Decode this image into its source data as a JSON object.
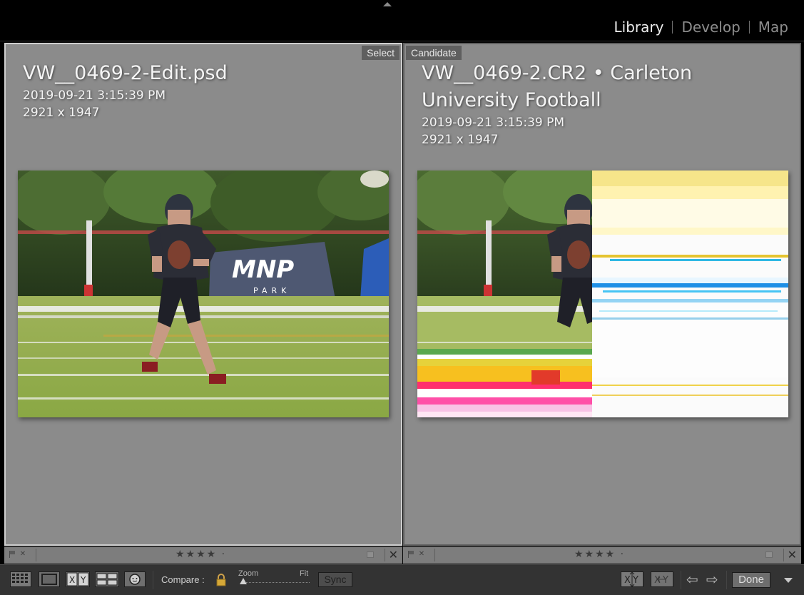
{
  "modules": [
    "Library",
    "Develop",
    "Map"
  ],
  "active_module": "Library",
  "select": {
    "tag": "Select",
    "filename": "VW__0469-2-Edit.psd",
    "date": "2019-09-21 3:15:39 PM",
    "dimensions": "2921 x 1947"
  },
  "candidate": {
    "tag": "Candidate",
    "filename_line1": "VW__0469-2.CR2 • Carleton",
    "filename_line2": "University Football",
    "date": "2019-09-21 3:15:39 PM",
    "dimensions": "2921 x 1947"
  },
  "footer": {
    "stars": "★★★★ ·",
    "reject": "✕",
    "close": "✕"
  },
  "toolbar": {
    "compare_label": "Compare :",
    "zoom_label": "Zoom",
    "fit_label": "Fit",
    "zoom_level": 0,
    "sync_label": "Sync",
    "done_label": "Done",
    "prev_arrow": "⇦",
    "next_arrow": "⇨"
  },
  "photo": {
    "banner_text": "MNP",
    "banner_subtext": "PARK"
  },
  "colors": {
    "panel_bg": "#8b8b8b",
    "selected_border": "#cfcfcf",
    "toolbar_bg": "#333333",
    "active_module": "#ececec",
    "inactive_module": "#8d8d8d"
  }
}
